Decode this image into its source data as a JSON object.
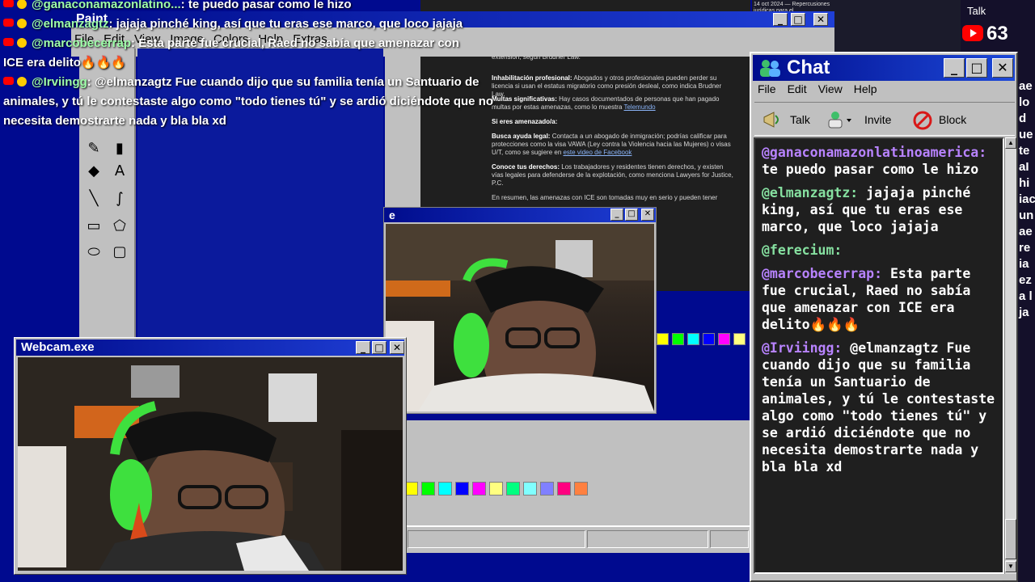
{
  "paint": {
    "title": "Paint",
    "menu": [
      "File",
      "Edit",
      "View",
      "Image",
      "Colors",
      "Help",
      "Extras"
    ],
    "palette_bottom": [
      "#ffff00",
      "#00ff00",
      "#00ffff",
      "#0000ff",
      "#ff00ff",
      "#ffff80",
      "#00ff80",
      "#80ffff",
      "#8080ff",
      "#ff0080",
      "#ff8040"
    ],
    "palette_top": [
      "#ffff00",
      "#00ff00",
      "#00ffff",
      "#0000ff",
      "#ff00ff",
      "#ffff80"
    ]
  },
  "overlay_chat": [
    {
      "user": "@ganaconamazonlatino...",
      "text": ": te puedo pasar como le hizo"
    },
    {
      "user": "@elmanzagtz",
      "text": ": jajaja pinché king, así que tu eras ese marco, que loco jajaja"
    },
    {
      "user": "@marcobecerrap",
      "text": ": Esta parte fue crucial, Raed no sabía que amenazar con"
    },
    {
      "user": "",
      "text": "ICE era delito🔥🔥🔥"
    },
    {
      "user": "@Irviingg",
      "text": ": @elmanzagtz Fue cuando dijo que su familia tenía un Santuario de"
    },
    {
      "user": "",
      "text": "animales, y tú le contestaste algo como \"todo tienes tú\" y se ardió diciéndote que no"
    },
    {
      "user": "",
      "text": "necesita demostrarte nada y bla bla xd"
    }
  ],
  "browser": {
    "lines": [
      {
        "b": "",
        "t": "extensión, según Brudner Law."
      },
      {
        "b": "Inhabilitación profesional:",
        "t": " Abogados y otros profesionales pueden perder su licencia si usan el estatus migratorio como presión desleal, como indica Brudner Law."
      },
      {
        "b": "Multas significativas:",
        "t": " Hay casos documentados de personas que han pagado multas por estas amenazas, como lo muestra ",
        "link": "Telemundo"
      },
      {
        "b": "Si eres amenazado/a:",
        "t": ""
      },
      {
        "b": "Busca ayuda legal:",
        "t": " Contacta a un abogado de inmigración; podrías calificar para protecciones como la visa VAWA (Ley contra la Violencia hacia las Mujeres) o visas U/T, como se sugiere en ",
        "link": "este video de Facebook"
      },
      {
        "b": "Conoce tus derechos:",
        "t": " Los trabajadores y residentes tienen derechos, y existen vías legales para defenderse de la explotación, como menciona Lawyers for Justice, P.C."
      },
      {
        "b": "",
        "t": "En resumen, las amenazas con ICE son tomadas muy en serio y pueden tener"
      }
    ],
    "news_date": "14 oct 2024 — Repercusiones jurídicas para el"
  },
  "youtube": {
    "count": "63"
  },
  "talk_mini": "Talk",
  "right_frags": [
    "ae",
    "lo",
    "d",
    "ue",
    "te",
    "aI",
    "hi",
    "iac",
    "un",
    "ae",
    "re",
    "ia",
    "ez",
    "a l",
    "ja"
  ],
  "mid_window": {
    "title": "e"
  },
  "webcam": {
    "title": "Webcam.exe"
  },
  "chat": {
    "title": "Chat",
    "menu": [
      "File",
      "Edit",
      "View",
      "Help"
    ],
    "tools": [
      "Talk",
      "Invite",
      "Block"
    ],
    "messages": [
      {
        "user": "@ganaconamazonlatinoamerica:",
        "text": " te puedo pasar como le hizo",
        "color": "purple"
      },
      {
        "user": "@elmanzagtz:",
        "text": " jajaja pinché king, así que tu eras ese marco, que loco jajaja",
        "color": "green"
      },
      {
        "user": "@ferecium:",
        "text": "",
        "color": "green"
      },
      {
        "user": "@marcobecerrap:",
        "text": " Esta parte fue crucial, Raed no sabía que amenazar con ICE era delito🔥🔥🔥",
        "color": "purple"
      },
      {
        "user": "@Irviingg:",
        "text": " @elmanzagtz Fue cuando dijo que su familia tenía un Santuario de animales, y tú le contestaste algo como \"todo tienes tú\" y se ardió diciéndote que no necesita demostrarte nada y bla bla xd",
        "color": "purple"
      }
    ]
  },
  "colors": {
    "titlebar": "#000c8c",
    "desktop": "#000a8f",
    "chat_user_purple": "#b883ff",
    "chat_user_green": "#86e0a0"
  }
}
